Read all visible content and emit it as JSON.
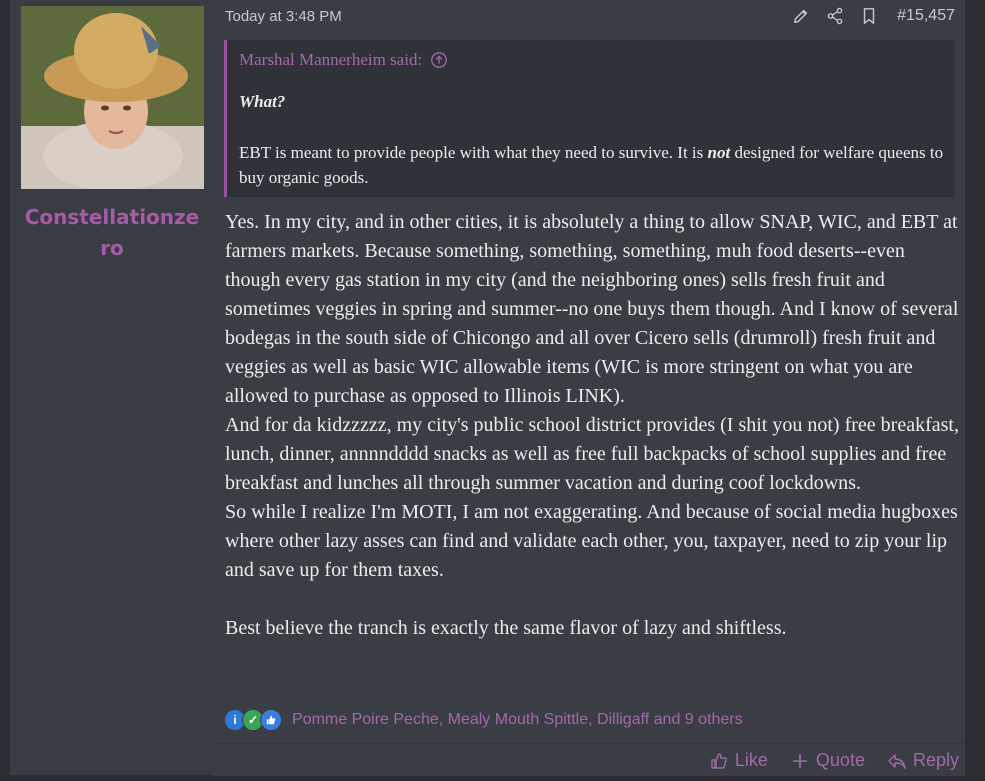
{
  "post": {
    "username": "Constellationzero",
    "timestamp": "Today at 3:48 PM",
    "post_number": "#15,457",
    "quote": {
      "author": "Marshal Mannerheim said:",
      "line1": "What?",
      "text_before": "EBT is meant to provide people with what they need to survive. It is ",
      "emphasis": "not",
      "text_after": " designed for welfare queens to buy organic goods."
    },
    "body": "Yes. In my city, and in other cities, it is absolutely a thing to allow SNAP, WIC, and EBT at farmers markets. Because something, something, something, muh food deserts--even though every gas station in my city (and the neighboring ones) sells fresh fruit and sometimes veggies in spring and summer--no one buys them though. And I know of several bodegas in the south side of Chicongo and all over Cicero sells (drumroll) fresh fruit and veggies as well as basic WIC allowable items (WIC is more stringent on what you are allowed to purchase as opposed to Illinois LINK).\nAnd for da kidzzzzz, my city's public school district provides (I shit you not) free breakfast, lunch, dinner, annnndddd snacks as well as free full backpacks of school supplies and free breakfast and lunches all through summer vacation and during coof lockdowns.\nSo while I realize I'm MOTI, I am not exaggerating. And because of social media hugboxes where other lazy asses can find and validate each other, you, taxpayer, need to zip your lip and save up for them taxes.\n\nBest believe the tranch is exactly the same flavor of lazy and shiftless.",
    "reactions": {
      "icons": [
        "info-icon",
        "check-icon",
        "thumbs-up-icon"
      ],
      "names": "Pomme Poire Peche, Mealy Mouth Spittle, Dilligaff and 9 others"
    },
    "actions": {
      "like": "Like",
      "quote": "Quote",
      "reply": "Reply"
    }
  },
  "colors": {
    "accent": "#a06aa8",
    "username": "#a75aa6",
    "background": "#3b3d45"
  }
}
